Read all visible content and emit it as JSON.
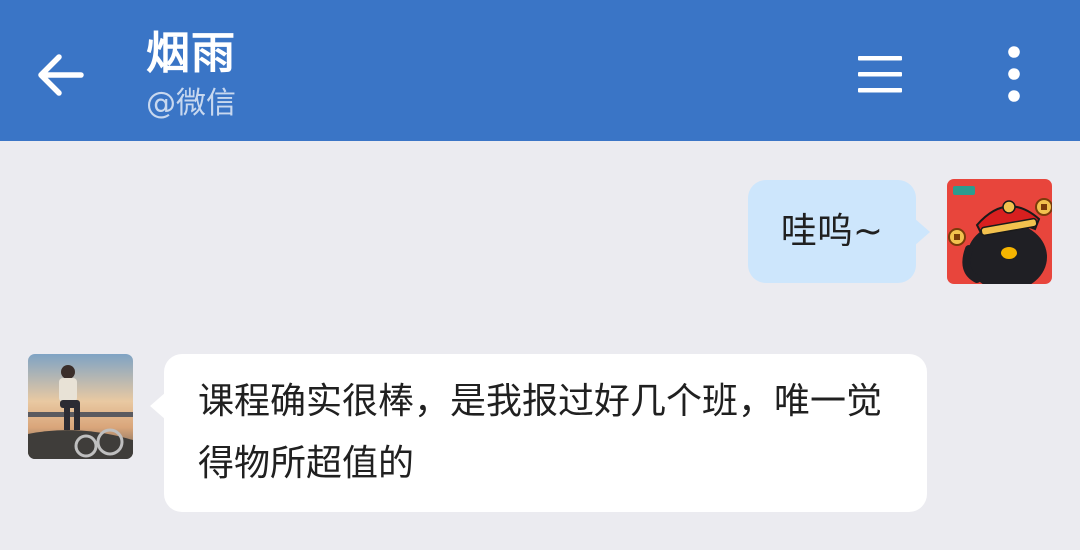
{
  "header": {
    "back_icon": "arrow-left-icon",
    "title": "烟雨",
    "subtitle": "@微信",
    "menu_icon": "hamburger-menu-icon",
    "more_icon": "more-vertical-icon",
    "background_color": "#3a75c6"
  },
  "messages": [
    {
      "direction": "outgoing",
      "text": "哇呜~",
      "avatar_icon": "cartoon-penguin-avatar",
      "bubble_color": "#cde6fc"
    },
    {
      "direction": "incoming",
      "text": "课程确实很棒，是我报过好几个班，唯一觉得物所超值的",
      "avatar_icon": "photo-avatar-person-sitting",
      "bubble_color": "#ffffff"
    }
  ],
  "chat_background": "#ebebf0"
}
